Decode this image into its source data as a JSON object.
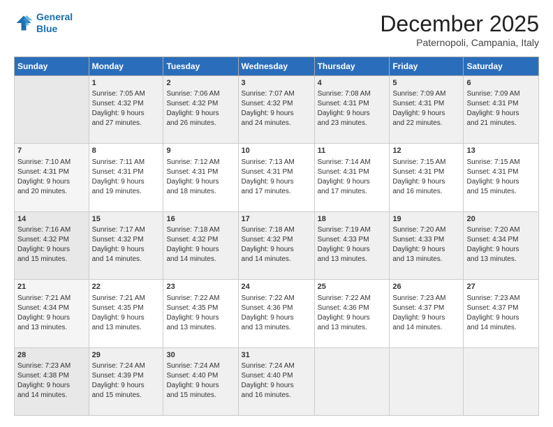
{
  "header": {
    "logo_line1": "General",
    "logo_line2": "Blue",
    "month": "December 2025",
    "location": "Paternopoli, Campania, Italy"
  },
  "weekdays": [
    "Sunday",
    "Monday",
    "Tuesday",
    "Wednesday",
    "Thursday",
    "Friday",
    "Saturday"
  ],
  "weeks": [
    [
      {
        "day": "",
        "text": ""
      },
      {
        "day": "1",
        "text": "Sunrise: 7:05 AM\nSunset: 4:32 PM\nDaylight: 9 hours\nand 27 minutes."
      },
      {
        "day": "2",
        "text": "Sunrise: 7:06 AM\nSunset: 4:32 PM\nDaylight: 9 hours\nand 26 minutes."
      },
      {
        "day": "3",
        "text": "Sunrise: 7:07 AM\nSunset: 4:32 PM\nDaylight: 9 hours\nand 24 minutes."
      },
      {
        "day": "4",
        "text": "Sunrise: 7:08 AM\nSunset: 4:31 PM\nDaylight: 9 hours\nand 23 minutes."
      },
      {
        "day": "5",
        "text": "Sunrise: 7:09 AM\nSunset: 4:31 PM\nDaylight: 9 hours\nand 22 minutes."
      },
      {
        "day": "6",
        "text": "Sunrise: 7:09 AM\nSunset: 4:31 PM\nDaylight: 9 hours\nand 21 minutes."
      }
    ],
    [
      {
        "day": "7",
        "text": "Sunrise: 7:10 AM\nSunset: 4:31 PM\nDaylight: 9 hours\nand 20 minutes."
      },
      {
        "day": "8",
        "text": "Sunrise: 7:11 AM\nSunset: 4:31 PM\nDaylight: 9 hours\nand 19 minutes."
      },
      {
        "day": "9",
        "text": "Sunrise: 7:12 AM\nSunset: 4:31 PM\nDaylight: 9 hours\nand 18 minutes."
      },
      {
        "day": "10",
        "text": "Sunrise: 7:13 AM\nSunset: 4:31 PM\nDaylight: 9 hours\nand 17 minutes."
      },
      {
        "day": "11",
        "text": "Sunrise: 7:14 AM\nSunset: 4:31 PM\nDaylight: 9 hours\nand 17 minutes."
      },
      {
        "day": "12",
        "text": "Sunrise: 7:15 AM\nSunset: 4:31 PM\nDaylight: 9 hours\nand 16 minutes."
      },
      {
        "day": "13",
        "text": "Sunrise: 7:15 AM\nSunset: 4:31 PM\nDaylight: 9 hours\nand 15 minutes."
      }
    ],
    [
      {
        "day": "14",
        "text": "Sunrise: 7:16 AM\nSunset: 4:32 PM\nDaylight: 9 hours\nand 15 minutes."
      },
      {
        "day": "15",
        "text": "Sunrise: 7:17 AM\nSunset: 4:32 PM\nDaylight: 9 hours\nand 14 minutes."
      },
      {
        "day": "16",
        "text": "Sunrise: 7:18 AM\nSunset: 4:32 PM\nDaylight: 9 hours\nand 14 minutes."
      },
      {
        "day": "17",
        "text": "Sunrise: 7:18 AM\nSunset: 4:32 PM\nDaylight: 9 hours\nand 14 minutes."
      },
      {
        "day": "18",
        "text": "Sunrise: 7:19 AM\nSunset: 4:33 PM\nDaylight: 9 hours\nand 13 minutes."
      },
      {
        "day": "19",
        "text": "Sunrise: 7:20 AM\nSunset: 4:33 PM\nDaylight: 9 hours\nand 13 minutes."
      },
      {
        "day": "20",
        "text": "Sunrise: 7:20 AM\nSunset: 4:34 PM\nDaylight: 9 hours\nand 13 minutes."
      }
    ],
    [
      {
        "day": "21",
        "text": "Sunrise: 7:21 AM\nSunset: 4:34 PM\nDaylight: 9 hours\nand 13 minutes."
      },
      {
        "day": "22",
        "text": "Sunrise: 7:21 AM\nSunset: 4:35 PM\nDaylight: 9 hours\nand 13 minutes."
      },
      {
        "day": "23",
        "text": "Sunrise: 7:22 AM\nSunset: 4:35 PM\nDaylight: 9 hours\nand 13 minutes."
      },
      {
        "day": "24",
        "text": "Sunrise: 7:22 AM\nSunset: 4:36 PM\nDaylight: 9 hours\nand 13 minutes."
      },
      {
        "day": "25",
        "text": "Sunrise: 7:22 AM\nSunset: 4:36 PM\nDaylight: 9 hours\nand 13 minutes."
      },
      {
        "day": "26",
        "text": "Sunrise: 7:23 AM\nSunset: 4:37 PM\nDaylight: 9 hours\nand 14 minutes."
      },
      {
        "day": "27",
        "text": "Sunrise: 7:23 AM\nSunset: 4:37 PM\nDaylight: 9 hours\nand 14 minutes."
      }
    ],
    [
      {
        "day": "28",
        "text": "Sunrise: 7:23 AM\nSunset: 4:38 PM\nDaylight: 9 hours\nand 14 minutes."
      },
      {
        "day": "29",
        "text": "Sunrise: 7:24 AM\nSunset: 4:39 PM\nDaylight: 9 hours\nand 15 minutes."
      },
      {
        "day": "30",
        "text": "Sunrise: 7:24 AM\nSunset: 4:40 PM\nDaylight: 9 hours\nand 15 minutes."
      },
      {
        "day": "31",
        "text": "Sunrise: 7:24 AM\nSunset: 4:40 PM\nDaylight: 9 hours\nand 16 minutes."
      },
      {
        "day": "",
        "text": ""
      },
      {
        "day": "",
        "text": ""
      },
      {
        "day": "",
        "text": ""
      }
    ]
  ]
}
